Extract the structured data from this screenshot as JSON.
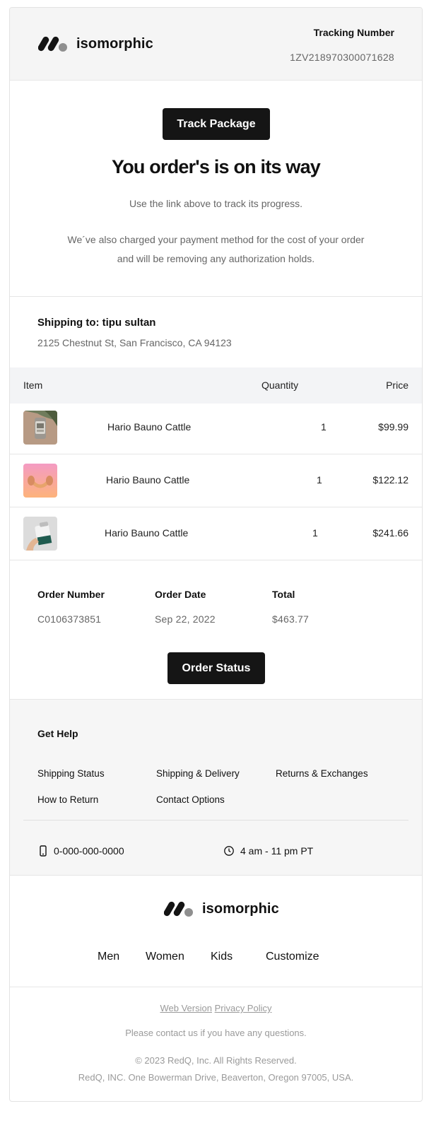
{
  "brand": {
    "name": "isomorphic"
  },
  "header": {
    "tracking_label": "Tracking Number",
    "tracking_number": "1ZV218970300071628"
  },
  "hero": {
    "track_button": "Track Package",
    "title": "You order's is on its way",
    "line1": "Use the link above to track its progress.",
    "line2": "We´ve also charged your payment method for the cost of your order",
    "line3": "and will be removing any authorization holds."
  },
  "shipping": {
    "title": "Shipping to: tipu sultan",
    "address": "2125 Chestnut St, San Francisco, CA 94123"
  },
  "items_table": {
    "headers": {
      "item": "Item",
      "quantity": "Quantity",
      "price": "Price"
    },
    "rows": [
      {
        "name": "Hario Bauno Cattle",
        "quantity": "1",
        "price": "$99.99",
        "image": "watch-product-photo"
      },
      {
        "name": "Hario Bauno Cattle",
        "quantity": "1",
        "price": "$122.12",
        "image": "headphones-product-photo"
      },
      {
        "name": "Hario Bauno Cattle",
        "quantity": "1",
        "price": "$241.66",
        "image": "cosmetic-product-photo"
      }
    ]
  },
  "order": {
    "number_label": "Order Number",
    "number": "C0106373851",
    "date_label": "Order Date",
    "date": "Sep 22, 2022",
    "total_label": "Total",
    "total": "$463.77",
    "status_button": "Order Status"
  },
  "help": {
    "title": "Get Help",
    "links": [
      "Shipping Status",
      "Shipping & Delivery",
      "Returns & Exchanges",
      "How to Return",
      "Contact Options"
    ],
    "phone": "0-000-000-0000",
    "hours": "4 am - 11 pm PT",
    "phone_icon": "phone-icon",
    "clock_icon": "clock-icon"
  },
  "footer": {
    "nav": [
      "Men",
      "Women",
      "Kids",
      "Customize"
    ],
    "web_version": "Web Version",
    "privacy_policy": "Privacy Policy",
    "contact_note": "Please contact us if you have any questions.",
    "copyright": "© 2023 RedQ, Inc. All Rights Reserved.",
    "address": "RedQ, INC. One Bowerman Drive, Beaverton, Oregon 97005, USA."
  },
  "colors": {
    "button": "#151515",
    "muted_text": "#666666",
    "panel": "#f5f5f5"
  }
}
